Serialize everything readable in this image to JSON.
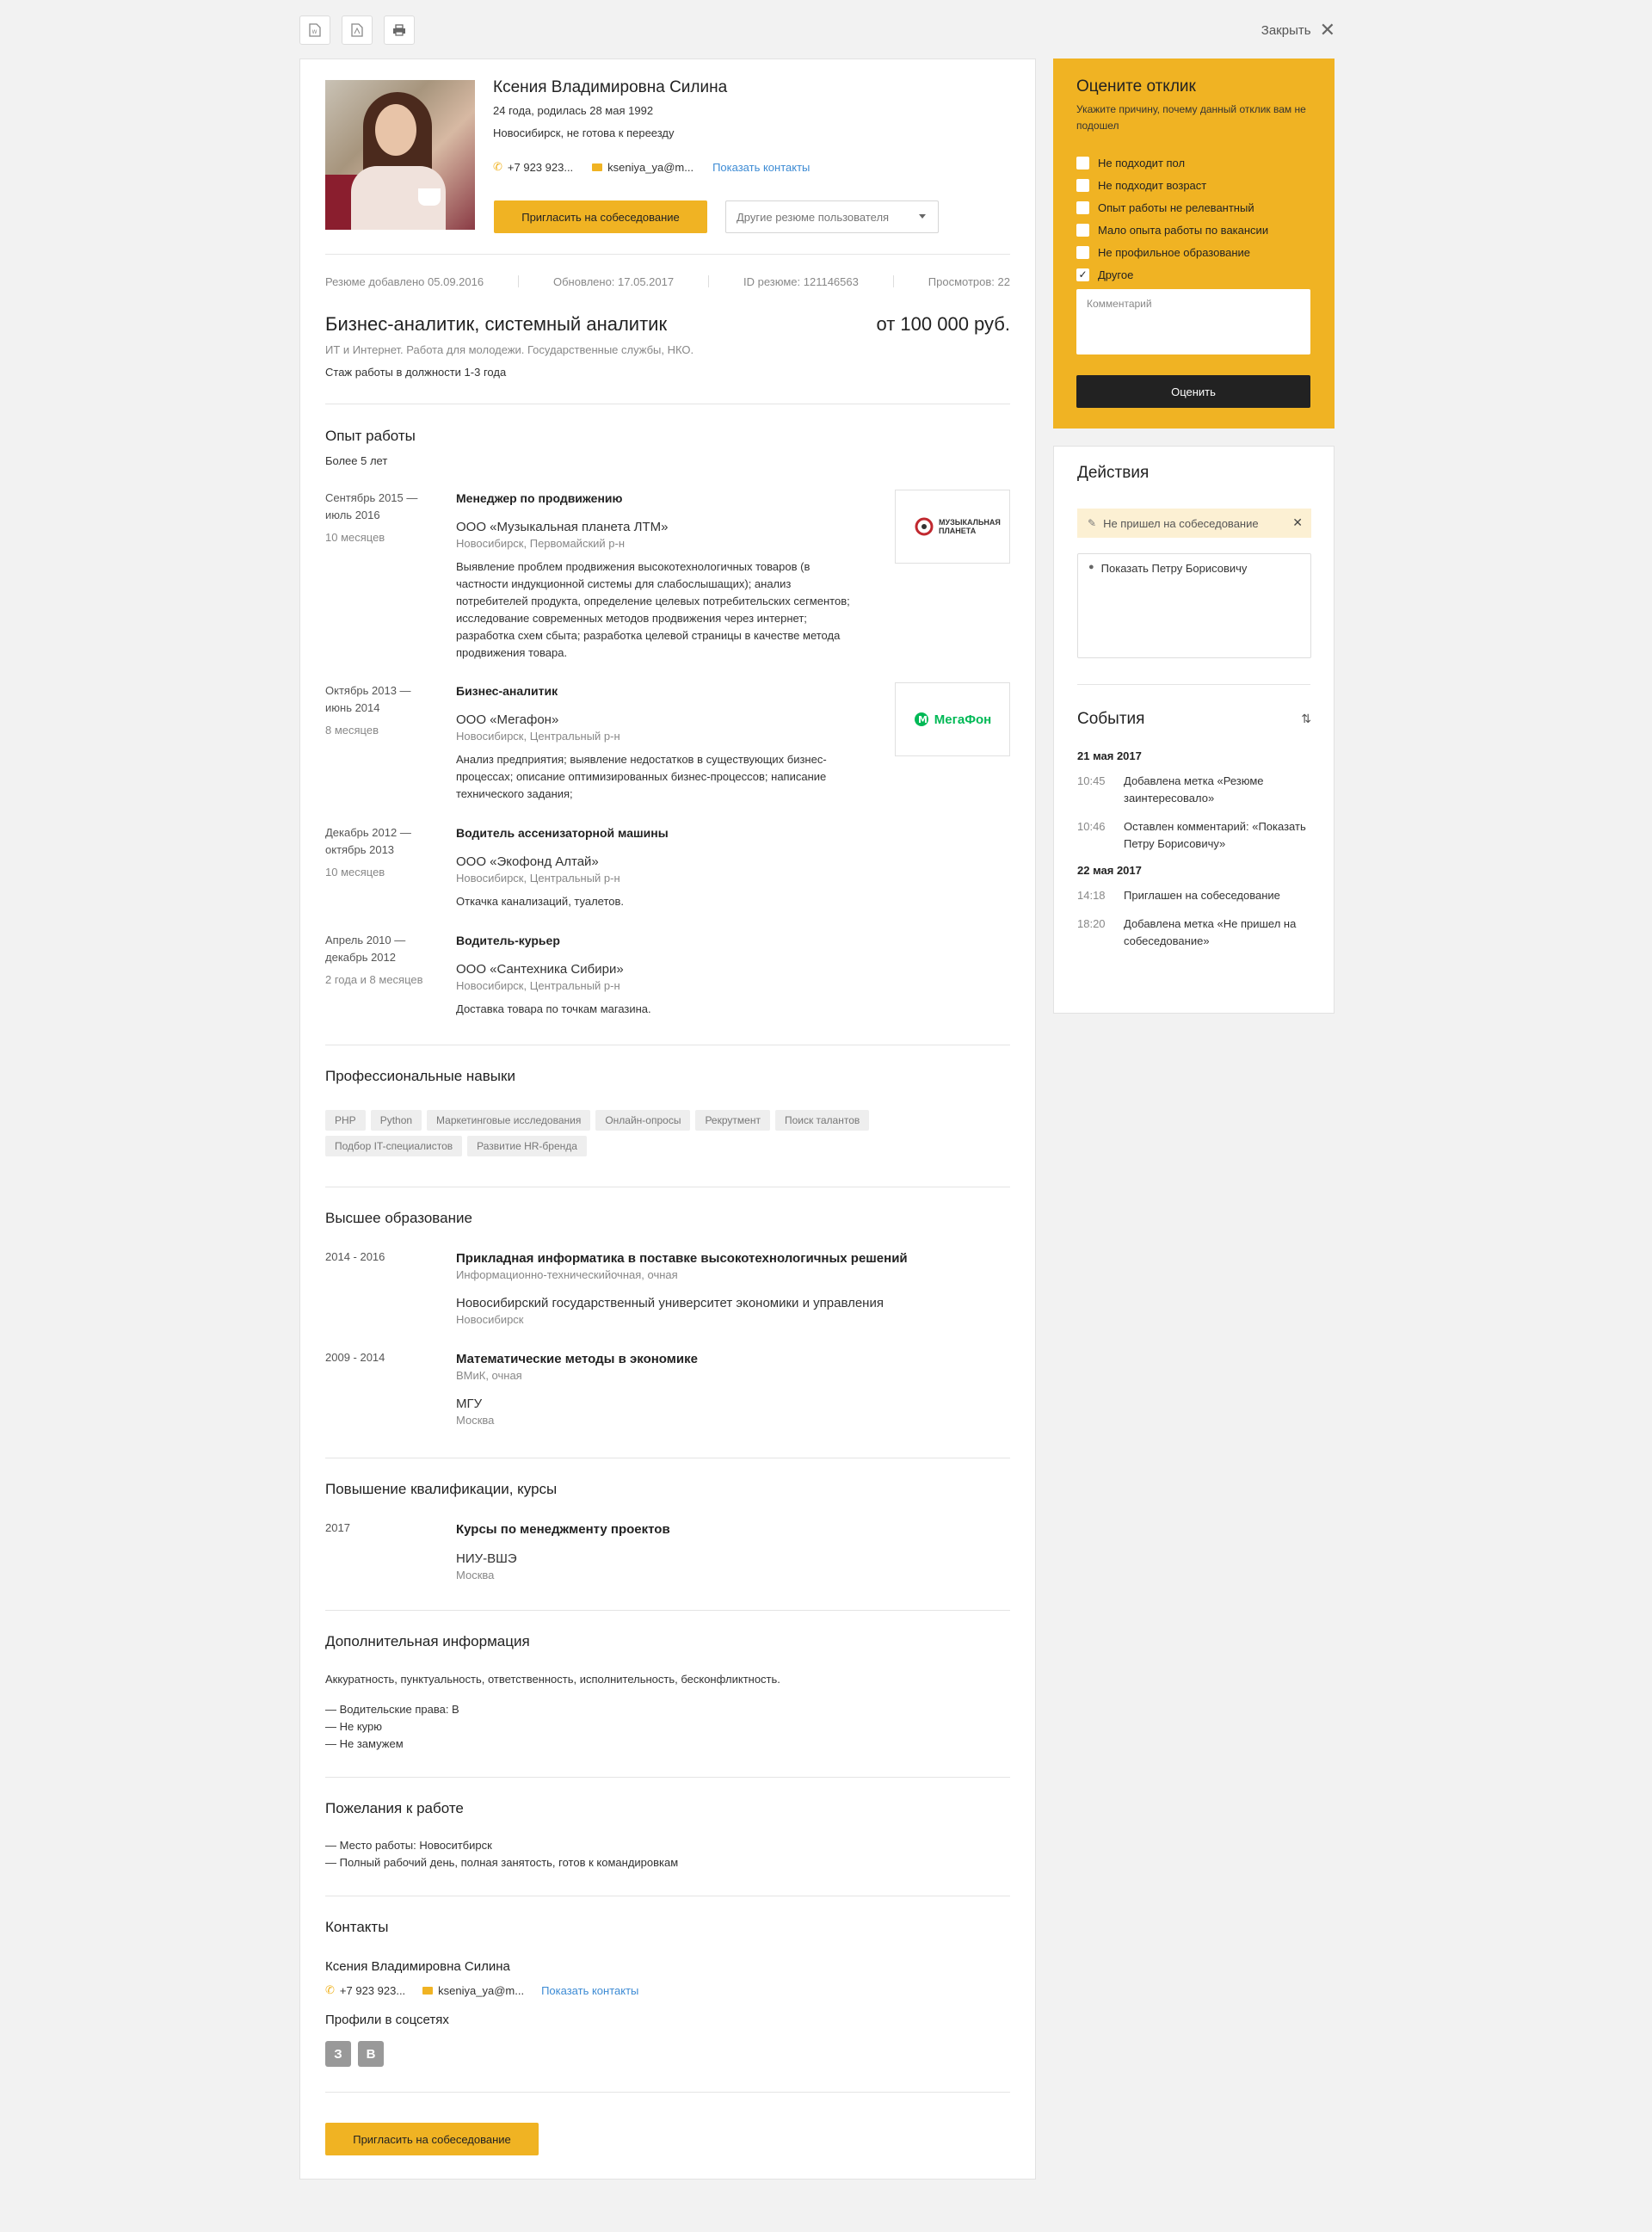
{
  "toolbar": {
    "icons": [
      "word-icon",
      "pdf-icon",
      "print-icon"
    ],
    "close_label": "Закрыть"
  },
  "candidate": {
    "name": "Ксения Владимировна Силина",
    "age_birth": "24 года, родилась 28 мая 1992",
    "city": "Новосибирск, не готова к переезду",
    "phone": "+7 923 923...",
    "email": "kseniya_ya@m...",
    "show_contacts": "Показать контакты",
    "invite_button": "Пригласить на собеседование",
    "other_resumes": "Другие резюме пользователя"
  },
  "meta": {
    "added": "Резюме добавлено 05.09.2016",
    "updated": "Обновлено: 17.05.2017",
    "resume_id": "ID резюме: 121146563",
    "views": "Просмотров: 22"
  },
  "position": {
    "title": "Бизнес-аналитик, системный аналитик",
    "salary": "от 100 000 руб.",
    "spheres": "ИТ и Интернет. Работа для молодежи. Государственные службы, НКО.",
    "stage": "Стаж работы в должности 1-3 года"
  },
  "experience": {
    "title": "Опыт работы",
    "total": "Более 5 лет",
    "jobs": [
      {
        "dates": "Сентябрь 2015 —\nиюль 2016",
        "duration": "10 месяцев",
        "role": "Менеджер по продвижению",
        "company": "ООО «Музыкальная планета ЛТМ»",
        "location": "Новосибирск, Первомайский р-н",
        "description": "Выявление проблем продвижения высокотехнологичных товаров (в частности индукционной системы для слабослышащих); анализ потребителей продукта, определение целевых потребительских сегментов; исследование современных методов продвижения через интернет; разработка схем сбыта; разработка целевой страницы в качестве метода продвижения товара.",
        "logo_text": "МУЗЫКАЛЬНАЯ ПЛАНЕТА"
      },
      {
        "dates": "Октябрь 2013 —\nиюнь 2014",
        "duration": "8 месяцев",
        "role": "Бизнес-аналитик",
        "company": "ООО «Мегафон»",
        "location": "Новосибирск, Центральный р-н",
        "description": "Анализ предприятия; выявление недостатков в существующих бизнес-процессах; описание оптимизированных бизнес-процессов; написание технического задания;",
        "logo_text": "МегаФон"
      },
      {
        "dates": "Декабрь 2012 —\nоктябрь 2013",
        "duration": "10 месяцев",
        "role": "Водитель ассенизаторной машины",
        "company": "ООО «Экофонд Алтай»",
        "location": "Новосибирск, Центральный р-н",
        "description": "Откачка канализаций, туалетов."
      },
      {
        "dates": "Апрель 2010 —\nдекабрь 2012",
        "duration": "2 года и 8 месяцев",
        "role": "Водитель-курьер",
        "company": "ООО «Сантехника Сибири»",
        "location": "Новосибирск, Центральный р-н",
        "description": "Доставка товара по точкам магазина."
      }
    ]
  },
  "skills": {
    "title": "Профессиональные навыки",
    "items": [
      "PHP",
      "Python",
      "Маркетинговые исследования",
      "Онлайн-опросы",
      "Рекрутмент",
      "Поиск талантов",
      "Подбор IT-специалистов",
      "Развитие HR-бренда"
    ]
  },
  "education": {
    "title": "Высшее образование",
    "items": [
      {
        "years": "2014 - 2016",
        "specialty": "Прикладная информатика в поставке высокотехнологичных решений",
        "faculty": "Информационно-техническийочная, очная",
        "university": "Новосибирский государственный университет экономики и управления",
        "city": "Новосибирск"
      },
      {
        "years": "2009 - 2014",
        "specialty": "Математические методы в экономике",
        "faculty": "ВМиК, очная",
        "university": "МГУ",
        "city": "Москва"
      }
    ]
  },
  "courses": {
    "title": "Повышение квалификации, курсы",
    "items": [
      {
        "year": "2017",
        "name": "Курсы по менеджменту проектов",
        "org": "НИУ-ВШЭ",
        "city": "Москва"
      }
    ]
  },
  "additional": {
    "title": "Дополнительная информация",
    "text": "Аккуратность, пунктуальность, ответственность, исполнительность, бесконфликтность.",
    "lines": [
      "— Водительские права: B",
      "— Не курю",
      "— Не замужем"
    ]
  },
  "wishes": {
    "title": "Пожелания к работе",
    "lines": [
      "— Место работы: Новоситбирск",
      "— Полный рабочий день, полная занятость, готов к командировкам"
    ]
  },
  "contacts": {
    "title": "Контакты",
    "name": "Ксения Владимировна Силина",
    "phone": "+7 923 923...",
    "email": "kseniya_ya@m...",
    "show_contacts": "Показать контакты",
    "social_title": "Профили в соцсетях",
    "socials": [
      "З",
      "В"
    ]
  },
  "bottom_invite": "Пригласить на собеседование",
  "rating": {
    "title": "Оцените отклик",
    "subtitle": "Укажите причину, почему данный отклик вам не подошел",
    "reasons": [
      {
        "label": "Не подходит пол",
        "checked": false
      },
      {
        "label": "Не подходит возраст",
        "checked": false
      },
      {
        "label": "Опыт работы не релевантный",
        "checked": false
      },
      {
        "label": "Мало опыта работы по вакансии",
        "checked": false
      },
      {
        "label": "Не профильное образование",
        "checked": false
      },
      {
        "label": "Другое",
        "checked": true
      }
    ],
    "comment_placeholder": "Комментарий",
    "submit": "Оценить"
  },
  "actions": {
    "title": "Действия",
    "tag": "Не пришел на собеседование",
    "note": "Показать Петру Борисовичу",
    "events_title": "События",
    "events": [
      {
        "date": "21 мая 2017",
        "items": [
          {
            "time": "10:45",
            "text": "Добавлена метка «Резюме заинтересовало»"
          },
          {
            "time": "10:46",
            "text": "Оставлен комментарий: «Показать Петру Борисовичу»"
          }
        ]
      },
      {
        "date": "22 мая 2017",
        "items": [
          {
            "time": "14:18",
            "text": "Приглашен на собеседование"
          },
          {
            "time": "18:20",
            "text": "Добавлена метка «Не пришел на собеседование»"
          }
        ]
      }
    ]
  },
  "colors": {
    "accent": "#f0b323",
    "link": "#3d8bd4",
    "dark_button": "#222222",
    "background": "#f2f2f2",
    "megafon_green": "#00b956"
  }
}
